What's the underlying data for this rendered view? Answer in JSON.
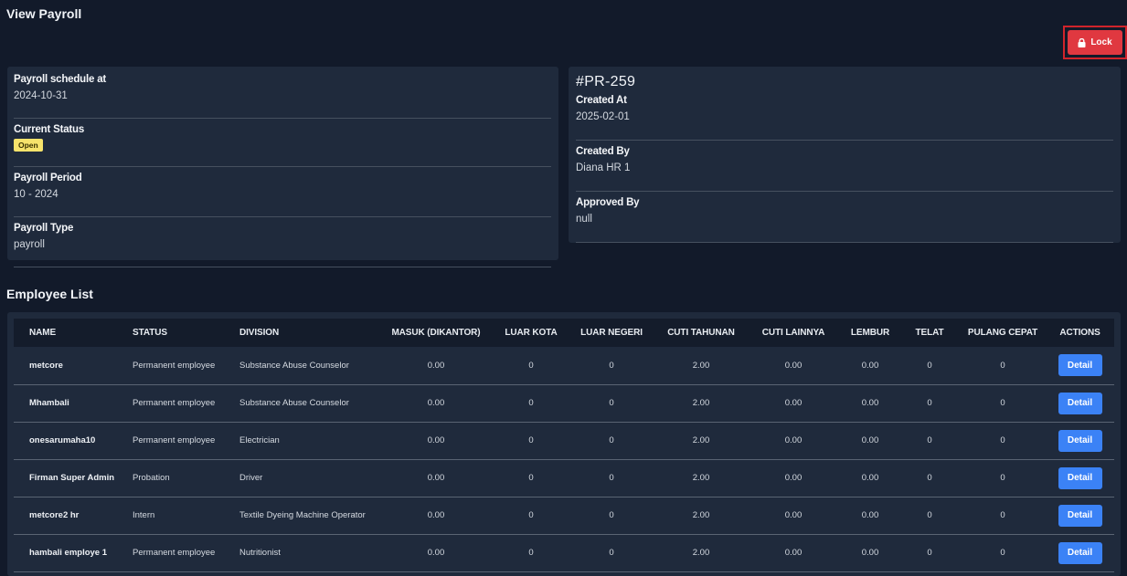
{
  "page": {
    "title": "View Payroll"
  },
  "toolbar": {
    "lock_label": "Lock"
  },
  "summary": {
    "schedule_label": "Payroll schedule at",
    "schedule_value": "2024-10-31",
    "status_label": "Current Status",
    "status_value": "Open",
    "period_label": "Payroll Period",
    "period_value": "10 - 2024",
    "type_label": "Payroll Type",
    "type_value": "payroll"
  },
  "meta": {
    "id": "#PR-259",
    "created_at_label": "Created At",
    "created_at_value": "2025-02-01",
    "created_by_label": "Created By",
    "created_by_value": "Diana HR 1",
    "approved_by_label": "Approved By",
    "approved_by_value": "null"
  },
  "employees": {
    "title": "Employee List",
    "columns": [
      "NAME",
      "STATUS",
      "DIVISION",
      "MASUK (DIKANTOR)",
      "LUAR KOTA",
      "LUAR NEGERI",
      "CUTI TAHUNAN",
      "CUTI LAINNYA",
      "LEMBUR",
      "TELAT",
      "PULANG CEPAT",
      "ACTIONS"
    ],
    "detail_label": "Detail",
    "rows": [
      [
        "metcore",
        "Permanent employee",
        "Substance Abuse Counselor",
        "0.00",
        "0",
        "0",
        "2.00",
        "0.00",
        "0.00",
        "0",
        "0"
      ],
      [
        "Mhambali",
        "Permanent employee",
        "Substance Abuse Counselor",
        "0.00",
        "0",
        "0",
        "2.00",
        "0.00",
        "0.00",
        "0",
        "0"
      ],
      [
        "onesarumaha10",
        "Permanent employee",
        "Electrician",
        "0.00",
        "0",
        "0",
        "2.00",
        "0.00",
        "0.00",
        "0",
        "0"
      ],
      [
        "Firman Super Admin",
        "Probation",
        "Driver",
        "0.00",
        "0",
        "0",
        "2.00",
        "0.00",
        "0.00",
        "0",
        "0"
      ],
      [
        "metcore2 hr",
        "Intern",
        "Textile Dyeing Machine Operator",
        "0.00",
        "0",
        "0",
        "2.00",
        "0.00",
        "0.00",
        "0",
        "0"
      ],
      [
        "hambali employe 1",
        "Permanent employee",
        "Nutritionist",
        "0.00",
        "0",
        "0",
        "2.00",
        "0.00",
        "0.00",
        "0",
        "0"
      ]
    ]
  }
}
